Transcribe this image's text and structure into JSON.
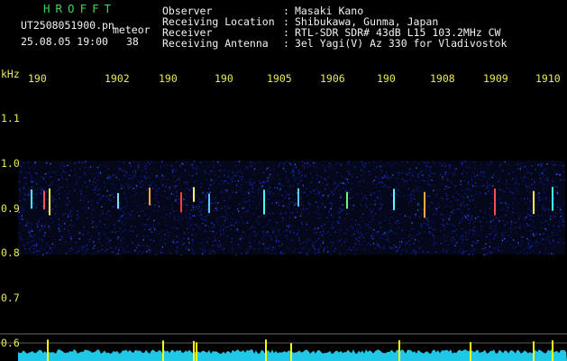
{
  "app": {
    "logo": "HROFFT",
    "file_name": "UT2508051900.pn",
    "mode": "meteor",
    "date_time": "25.08.05 19:00",
    "count": "38"
  },
  "info": {
    "labels": [
      "Observer",
      "Receiving Location",
      "Receiver",
      "Receiving Antenna"
    ],
    "separator": ":",
    "values": [
      "Masaki Kano",
      "Shibukawa, Gunma, Japan",
      "RTL-SDR SDR# 43dB L15 103.2MHz CW",
      "3el Yagi(V) Az 330 for Vladivostok"
    ]
  },
  "axes": {
    "y_unit": "kHz",
    "y_ticks": [
      "1.1",
      "1.0",
      "0.9",
      "0.8",
      "0.7",
      "0.6"
    ],
    "x_ticks": [
      "190",
      "1902",
      "190",
      "190",
      "1905",
      "1906",
      "190",
      "1908",
      "1909",
      "1910"
    ]
  },
  "colors": {
    "background": "#000000",
    "text": "#f2f2f2",
    "ticks": "#e9e95a",
    "logo": "#3fd65a",
    "noise_band": "#1a2fd0",
    "level_trace": "#1ec8e6",
    "signal_peak": "#ffff00"
  }
}
